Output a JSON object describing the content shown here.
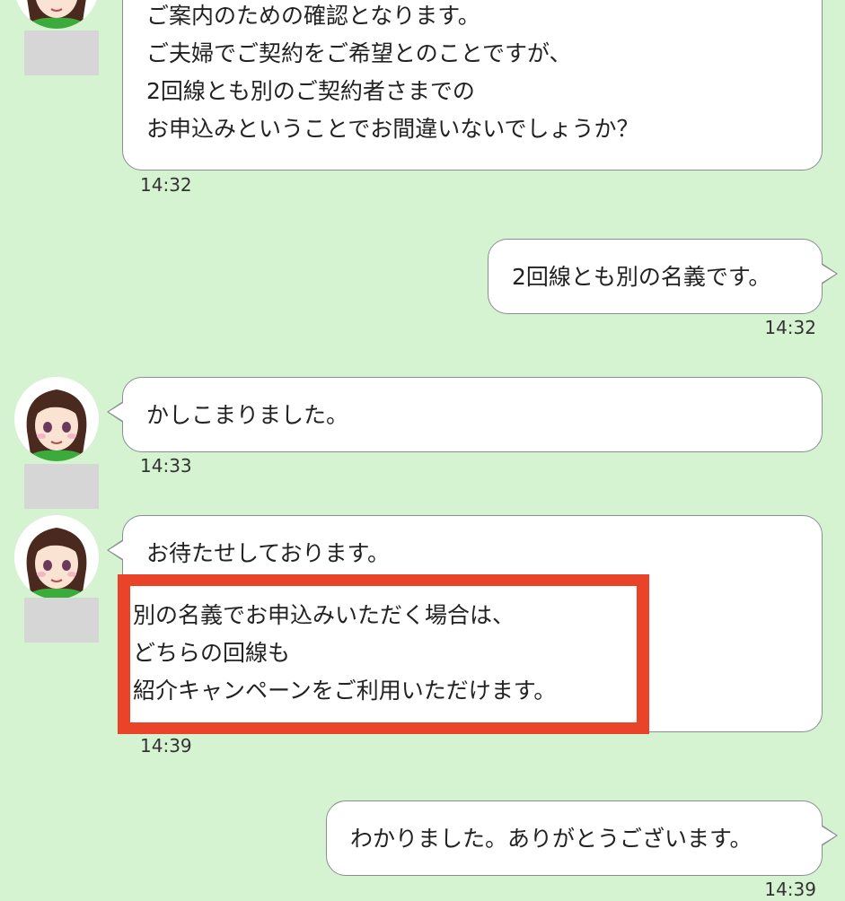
{
  "messages": [
    {
      "from": "operator",
      "lines": [
        "ご案内のための確認となります。",
        "ご夫婦でご契約をご希望とのことですが、",
        "2回線とも別のご契約者さまでの",
        "お申込みということでお間違いないでしょうか？"
      ],
      "time": "14:32"
    },
    {
      "from": "user",
      "lines": [
        "2回線とも別の名義です。"
      ],
      "time": "14:32"
    },
    {
      "from": "operator",
      "lines": [
        "かしこまりました。"
      ],
      "time": "14:33"
    },
    {
      "from": "operator",
      "lines": [
        "お待たせしております。"
      ],
      "highlighted_lines": [
        "別の名義でお申込みいただく場合は、",
        "どちらの回線も",
        "紹介キャンペーンをご利用いただけます。"
      ],
      "time": "14:39"
    },
    {
      "from": "user",
      "lines": [
        "わかりました。ありがとうございます。"
      ],
      "time": "14:39"
    }
  ],
  "colors": {
    "background": "#d5f2d1",
    "bubble": "#ffffff",
    "bubble_border": "#8a8e94",
    "highlight": "#e9442a",
    "placeholder": "#d6d6d6"
  },
  "icons": {
    "operator_avatar": "operator-avatar-icon"
  }
}
